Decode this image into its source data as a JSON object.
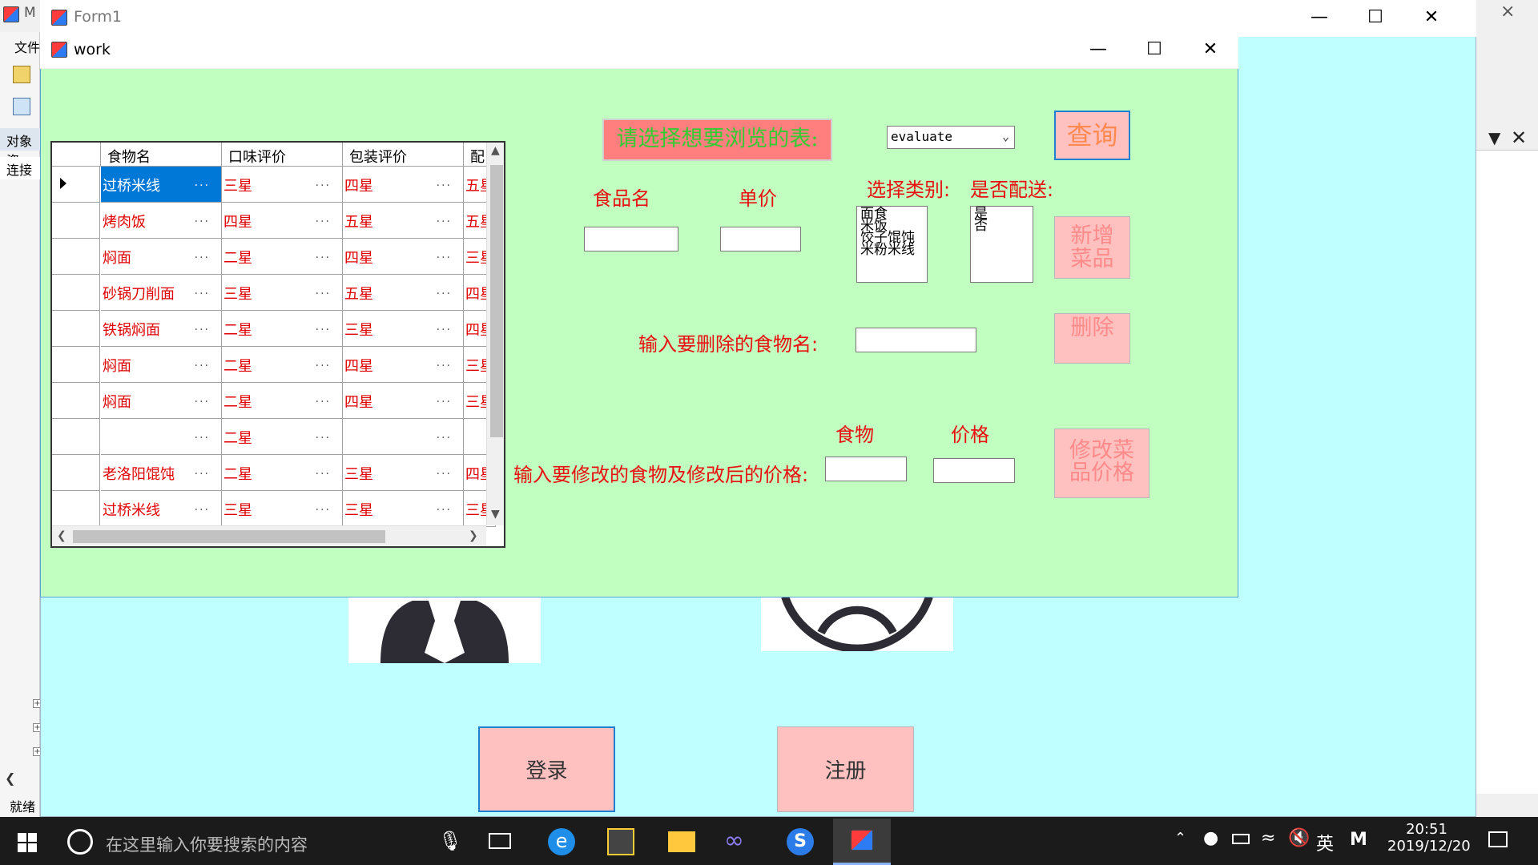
{
  "ide": {
    "title_fragment": "M",
    "menu_fragment": "文件",
    "tab1": "对象资",
    "tab2": "连接",
    "status": "就绪",
    "close_glyph": "×"
  },
  "form1": {
    "title": "Form1",
    "login_label": "登录",
    "register_label": "注册"
  },
  "work": {
    "title": "work",
    "grid": {
      "columns": [
        "食物名",
        "口味评价",
        "包装评价",
        "配"
      ],
      "rows": [
        [
          "过桥米线",
          "三星",
          "四星",
          "五星"
        ],
        [
          "烤肉饭",
          "四星",
          "五星",
          "五星"
        ],
        [
          "焖面",
          "二星",
          "四星",
          "三星"
        ],
        [
          "砂锅刀削面",
          "三星",
          "五星",
          "四星"
        ],
        [
          "铁锅焖面",
          "二星",
          "三星",
          "四星"
        ],
        [
          "焖面",
          "二星",
          "四星",
          "三星"
        ],
        [
          "焖面",
          "二星",
          "四星",
          "三星"
        ],
        [
          "",
          "二星",
          "",
          ""
        ],
        [
          "老洛阳馄饨",
          "二星",
          "三星",
          "四星"
        ],
        [
          "过桥米线",
          "三星",
          "三星",
          "三星"
        ]
      ],
      "cell_ellipsis": "..."
    },
    "choose_table_label": "请选择想要浏览的表:",
    "table_select_value": "evaluate",
    "query_button": "查询",
    "food_name_label": "食品名",
    "price_label": "单价",
    "category_label": "选择类别:",
    "category_options": [
      "面食",
      "米饭",
      "饺子馄饨",
      "米粉米线"
    ],
    "delivery_label": "是否配送:",
    "delivery_options": [
      "是",
      "否"
    ],
    "add_button_line1": "新增",
    "add_button_line2": "菜品",
    "delete_prompt": "输入要删除的食物名:",
    "delete_button": "删除",
    "modify_food_label": "食物",
    "modify_price_label": "价格",
    "modify_prompt": "输入要修改的食物及修改后的价格:",
    "modify_button_line1": "修改菜",
    "modify_button_line2": "品价格"
  },
  "taskbar": {
    "search_placeholder": "在这里输入你要搜索的内容",
    "ime": "英",
    "ime2": "M",
    "time": "20:51",
    "date": "2019/12/20"
  },
  "colors": {
    "form1_bg": "#c0ffff",
    "work_bg": "#c0ffc0",
    "label_red": "#e81010",
    "button_pink": "#ffc0c0",
    "selection_blue": "#0078d7",
    "choose_label_bg": "#ff7f7f",
    "choose_label_text": "#33cc33",
    "query_text": "#ff8a50"
  }
}
